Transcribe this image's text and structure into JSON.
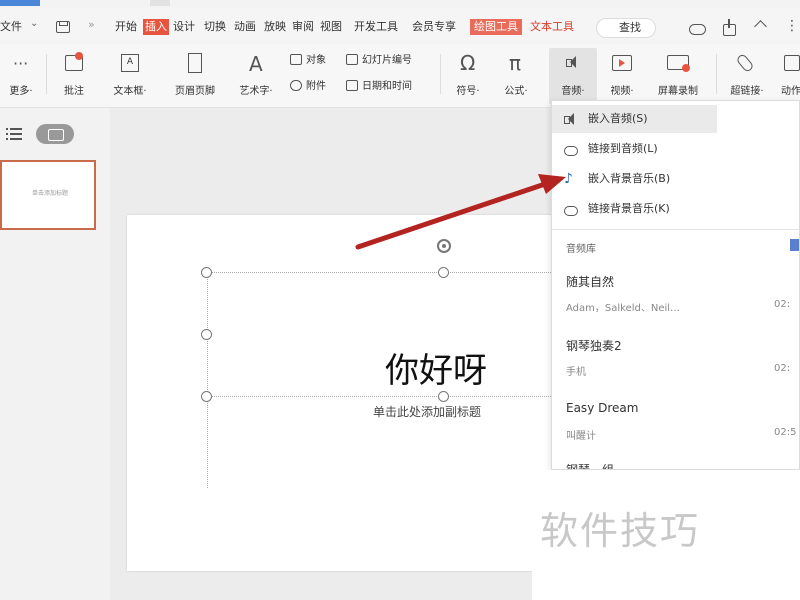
{
  "menubar": {
    "file": "文件",
    "tabs": [
      "开始",
      "插入",
      "设计",
      "切换",
      "动画",
      "放映",
      "审阅",
      "视图",
      "开发工具",
      "会员专享",
      "绘图工具",
      "文本工具"
    ],
    "active_tab": "插入",
    "search_placeholder": "查找"
  },
  "ribbon": {
    "more": "更多·",
    "comment": "批注",
    "textbox": "文本框·",
    "header_footer": "页眉页脚",
    "wordart": "艺术字·",
    "object": "对象",
    "attachment": "附件",
    "slide_number": "幻灯片编号",
    "date_time": "日期和时间",
    "symbol": "符号·",
    "formula": "公式·",
    "audio": "音频·",
    "video": "视频·",
    "screen_record": "屏幕录制",
    "hyperlink": "超链接·",
    "animation": "动作"
  },
  "thumbnail": {
    "number": "1",
    "text": "单击添加标题"
  },
  "slide": {
    "title": "你好呀",
    "subtitle": "单击此处添加副标题"
  },
  "audio_menu": {
    "items": [
      {
        "label": "嵌入音频(S)",
        "icon": "speaker-icon"
      },
      {
        "label": "链接到音频(L)",
        "icon": "cloud-link-icon"
      },
      {
        "label": "嵌入背景音乐(B)",
        "icon": "music-note-icon"
      },
      {
        "label": "链接背景音乐(K)",
        "icon": "cloud-music-icon"
      }
    ],
    "library_header": "音频库",
    "library": [
      {
        "title": "随其自然",
        "artist": "Adam，Salkeld、Neil…",
        "duration": "02:"
      },
      {
        "title": "钢琴独奏2",
        "artist": "手机",
        "duration": "02:"
      },
      {
        "title": "Easy Dream",
        "artist": "叫醒计",
        "duration": "02:5"
      },
      {
        "title": "钢琴一组",
        "artist": "",
        "duration": ""
      }
    ]
  },
  "watermark": "软件技巧",
  "colors": {
    "accent": "#e8553f",
    "arrow": "#b3231f",
    "music_note": "#2c6fb8",
    "thumb_border": "#c96a48"
  }
}
